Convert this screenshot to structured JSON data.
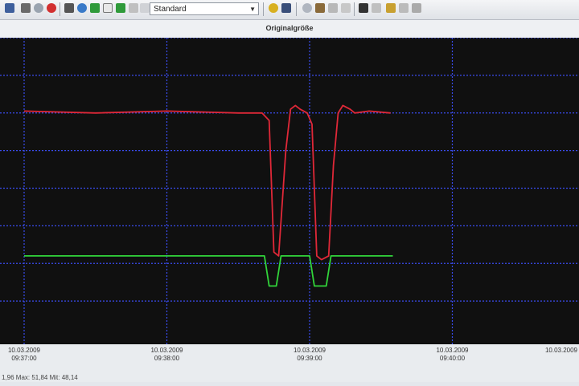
{
  "toolbar": {
    "mode_select_value": "Standard",
    "colors": {
      "button_blue": "#2a62c8",
      "button_red": "#d23030",
      "button_green": "#2f9a3a",
      "button_yellow": "#d8b020"
    }
  },
  "view": {
    "title": "Originalgröße"
  },
  "chart_data": {
    "type": "line",
    "x_unit": "time",
    "x_ticks": [
      {
        "date": "10.03.2009",
        "time": "09:37:00"
      },
      {
        "date": "10.03.2009",
        "time": "09:38:00"
      },
      {
        "date": "10.03.2009",
        "time": "09:39:00"
      },
      {
        "date": "10.03.2009",
        "time": "09:40:00"
      },
      {
        "date": "10.03.2009",
        "time": ""
      }
    ],
    "x_range": [
      "09:37:00",
      "09:41:00"
    ],
    "y_range": [
      0,
      8
    ],
    "grid": true,
    "series": [
      {
        "color": "#e02838",
        "x": [
          "09:37:00",
          "09:37:30",
          "09:38:00",
          "09:38:30",
          "09:38:40",
          "09:38:43",
          "09:38:45",
          "09:38:47",
          "09:38:50",
          "09:38:52",
          "09:38:54",
          "09:38:56",
          "09:38:59",
          "09:39:01",
          "09:39:03",
          "09:39:05",
          "09:39:08",
          "09:39:10",
          "09:39:12",
          "09:39:14",
          "09:39:17",
          "09:39:19",
          "09:39:25",
          "09:39:34"
        ],
        "y": [
          6.05,
          6.0,
          6.05,
          6.0,
          6.0,
          5.8,
          2.3,
          2.2,
          5.0,
          6.1,
          6.2,
          6.1,
          6.0,
          5.7,
          2.2,
          2.1,
          2.2,
          4.6,
          6.0,
          6.2,
          6.1,
          6.0,
          6.05,
          6.0
        ]
      },
      {
        "color": "#31d43a",
        "x": [
          "09:37:00",
          "09:38:41",
          "09:38:43",
          "09:38:46",
          "09:38:48",
          "09:39:00",
          "09:39:02",
          "09:39:07",
          "09:39:09",
          "09:39:35"
        ],
        "y": [
          2.2,
          2.2,
          1.4,
          1.4,
          2.2,
          2.2,
          1.4,
          1.4,
          2.2,
          2.2
        ]
      }
    ]
  },
  "status": {
    "text": "1,96 Max: 51,84 Mit: 48,14"
  }
}
